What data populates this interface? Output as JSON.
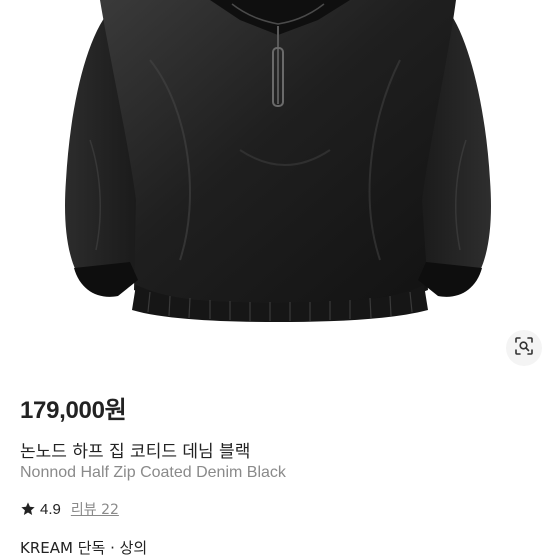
{
  "product": {
    "price": "179,000원",
    "name_ko": "논노드 하프 집 코티드 데님 블랙",
    "name_en": "Nonnod Half Zip Coated Denim Black",
    "rating": "4.9",
    "review_link": "리뷰 22",
    "category": "KREAM 단독 · 상의"
  },
  "icons": {
    "lens": "lens-search-icon",
    "star": "star-icon"
  },
  "colors": {
    "jacket": "#1c1c1c",
    "text_primary": "#222222",
    "text_secondary": "#8a8a8a"
  }
}
